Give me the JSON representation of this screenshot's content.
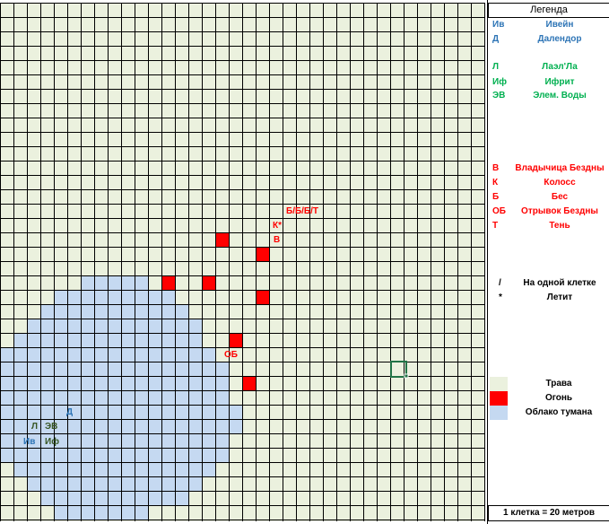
{
  "map": {
    "colors": {
      "grass": "#ebf1de",
      "fire": "#ff0000",
      "fog": "#c5d9f1",
      "grid": "#000000",
      "selected": "#217346"
    },
    "labels": [
      {
        "text": "Б/Б/Б/Т",
        "color": "red"
      },
      {
        "text": "К*",
        "color": "red"
      },
      {
        "text": "В",
        "color": "red"
      },
      {
        "text": "ОБ",
        "color": "red"
      },
      {
        "text": "Д",
        "color": "blue"
      },
      {
        "text": "Л",
        "color": "green"
      },
      {
        "text": "ЭВ",
        "color": "green"
      },
      {
        "text": "Ив",
        "color": "blue"
      },
      {
        "text": "Иф",
        "color": "green"
      }
    ]
  },
  "legend": {
    "title": "Легенда",
    "allies": [
      {
        "code": "Ив",
        "name": "Ивейн",
        "color": "blue"
      },
      {
        "code": "Д",
        "name": "Далендор",
        "color": "blue"
      },
      {
        "code": "Л",
        "name": "Лаэл'Ла",
        "color": "green"
      },
      {
        "code": "Иф",
        "name": "Ифрит",
        "color": "green"
      },
      {
        "code": "ЭВ",
        "name": "Элем. Воды",
        "color": "green"
      }
    ],
    "enemies": [
      {
        "code": "В",
        "name": "Владычица Бездны",
        "color": "red"
      },
      {
        "code": "К",
        "name": "Колосс",
        "color": "red"
      },
      {
        "code": "Б",
        "name": "Бес",
        "color": "red"
      },
      {
        "code": "ОБ",
        "name": "Отрывок Бездны",
        "color": "red"
      },
      {
        "code": "Т",
        "name": "Тень",
        "color": "red"
      }
    ],
    "symbols": [
      {
        "code": "/",
        "name": "На одной клетке"
      },
      {
        "code": "*",
        "name": "Летит"
      }
    ],
    "terrain": [
      {
        "swatch": "grass",
        "name": "Трава"
      },
      {
        "swatch": "fire",
        "name": "Огонь"
      },
      {
        "swatch": "fog",
        "name": "Облако тумана"
      }
    ],
    "scale": "1 клетка = 20 метров"
  }
}
